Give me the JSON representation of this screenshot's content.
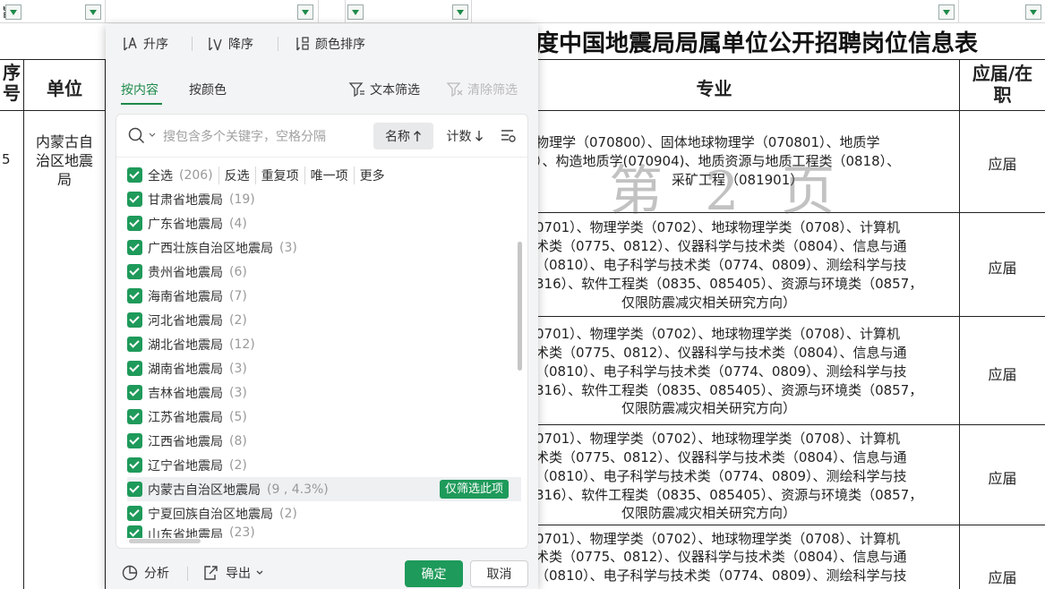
{
  "sheet": {
    "title": "度中国地震局局属单位公开招聘岗位信息表",
    "filter_corner_text": "旨",
    "header": {
      "seq": "序\n号",
      "unit": "单位",
      "major": "专业",
      "status": "应届/在\n职"
    },
    "row1": {
      "seq": "5",
      "unit": "内蒙古自治区地震局"
    },
    "major_rows": [
      {
        "lines": [
          "物理学（070800）、固体地球物理学（070801）、地质学",
          "）、构造地质学(070904)、地质资源与地质工程类（0818）、",
          "采矿工程（081901）"
        ],
        "status": "应届"
      },
      {
        "lines": [
          "0701）、物理学类（0702）、地球物理学类（0708）、计算机",
          "术类（0775、0812）、仪器科学与技术类（0804）、信息与通",
          "（0810）、电子科学与技术类（0774、0809）、测绘科学与技",
          "316）、软件工程类（0835、085405）、资源与环境类（0857，",
          "仅限防震减灾相关研究方向）"
        ],
        "status": "应届"
      },
      {
        "lines": [
          "0701）、物理学类（0702）、地球物理学类（0708）、计算机",
          "术类（0775、0812）、仪器科学与技术类（0804）、信息与通",
          "（0810）、电子科学与技术类（0774、0809）、测绘科学与技",
          "316）、软件工程类（0835、085405）、资源与环境类（0857，",
          "仅限防震减灾相关研究方向）"
        ],
        "status": "应届"
      },
      {
        "lines": [
          "0701）、物理学类（0702）、地球物理学类（0708）、计算机",
          "术类（0775、0812）、仪器科学与技术类（0804）、信息与通",
          "（0810）、电子科学与技术类（0774、0809）、测绘科学与技",
          "316）、软件工程类（0835、085405）、资源与环境类（0857，",
          "仅限防震减灾相关研究方向）"
        ],
        "status": "应届"
      },
      {
        "lines": [
          "0701）、物理学类（0702）、地球物理学类（0708）、计算机",
          "术类（0775、0812）、仪器科学与技术类（0804）、信息与通",
          "（0810）、电子科学与技术类（0774、0809）、测绘科学与技"
        ],
        "status": "应届"
      }
    ],
    "watermark": "第 2 页"
  },
  "panel": {
    "sort": {
      "asc": "升序",
      "desc": "降序",
      "color": "颜色排序"
    },
    "tabs": {
      "content": "按内容",
      "color": "按颜色"
    },
    "text_filter": "文本筛选",
    "clear_filter": "清除筛选",
    "search_placeholder": "搜包含多个关键字，空格分隔",
    "sort_name": "名称",
    "sort_count": "计数",
    "select_all": {
      "label": "全选",
      "count": "(206)"
    },
    "actions": [
      "反选",
      "重复项",
      "唯一项",
      "更多"
    ],
    "items": [
      {
        "label": "甘肃省地震局",
        "count": "(19)"
      },
      {
        "label": "广东省地震局",
        "count": "(4)"
      },
      {
        "label": "广西壮族自治区地震局",
        "count": "(3)"
      },
      {
        "label": "贵州省地震局",
        "count": "(6)"
      },
      {
        "label": "海南省地震局",
        "count": "(7)"
      },
      {
        "label": "河北省地震局",
        "count": "(2)"
      },
      {
        "label": "湖北省地震局",
        "count": "(12)"
      },
      {
        "label": "湖南省地震局",
        "count": "(3)"
      },
      {
        "label": "吉林省地震局",
        "count": "(3)"
      },
      {
        "label": "江苏省地震局",
        "count": "(5)"
      },
      {
        "label": "江西省地震局",
        "count": "(8)"
      },
      {
        "label": "辽宁省地震局",
        "count": "(2)"
      },
      {
        "label": "内蒙古自治区地震局",
        "count": "(9 , 4.3%)"
      },
      {
        "label": "宁夏回族自治区地震局",
        "count": "(2)"
      },
      {
        "label": "山东省地震局",
        "count": "(23)"
      }
    ],
    "only_this": "仅筛选此项",
    "analysis": "分析",
    "export": "导出",
    "ok": "确定",
    "cancel": "取消"
  }
}
